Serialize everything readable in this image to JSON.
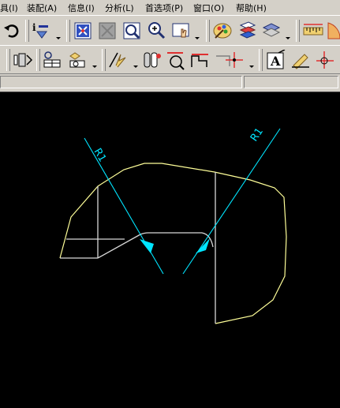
{
  "menu": [
    {
      "label": "具(I)"
    },
    {
      "label": "装配(A)"
    },
    {
      "label": "信息(I)"
    },
    {
      "label": "分析(L)"
    },
    {
      "label": "首选项(P)"
    },
    {
      "label": "窗口(O)"
    },
    {
      "label": "帮助(H)"
    }
  ],
  "icons_row1": [
    "undo-icon",
    "information-icon",
    "fit-view-icon",
    "refresh-view-icon",
    "zoom-window-icon",
    "zoom-icon",
    "pan-icon",
    "render-style-icon",
    "show-hide-icon",
    "layers-icon",
    "ruler-icon",
    "protractor-icon"
  ],
  "icons_row2": [
    "sketch-icon",
    "profile-icon",
    "constraint-icon",
    "quick-trim-icon",
    "dimension-icon",
    "offset-icon",
    "fillet-icon",
    "rectangle-icon",
    "point-icon",
    "text-icon",
    "edit-icon",
    "origin-icon"
  ],
  "drawing": {
    "dimension_left": "R1",
    "dimension_right": "R1",
    "colors": {
      "sketch": "#ffff99",
      "geometry": "#d8d8d8",
      "dimension": "#00e5ff",
      "background": "#000000"
    }
  }
}
